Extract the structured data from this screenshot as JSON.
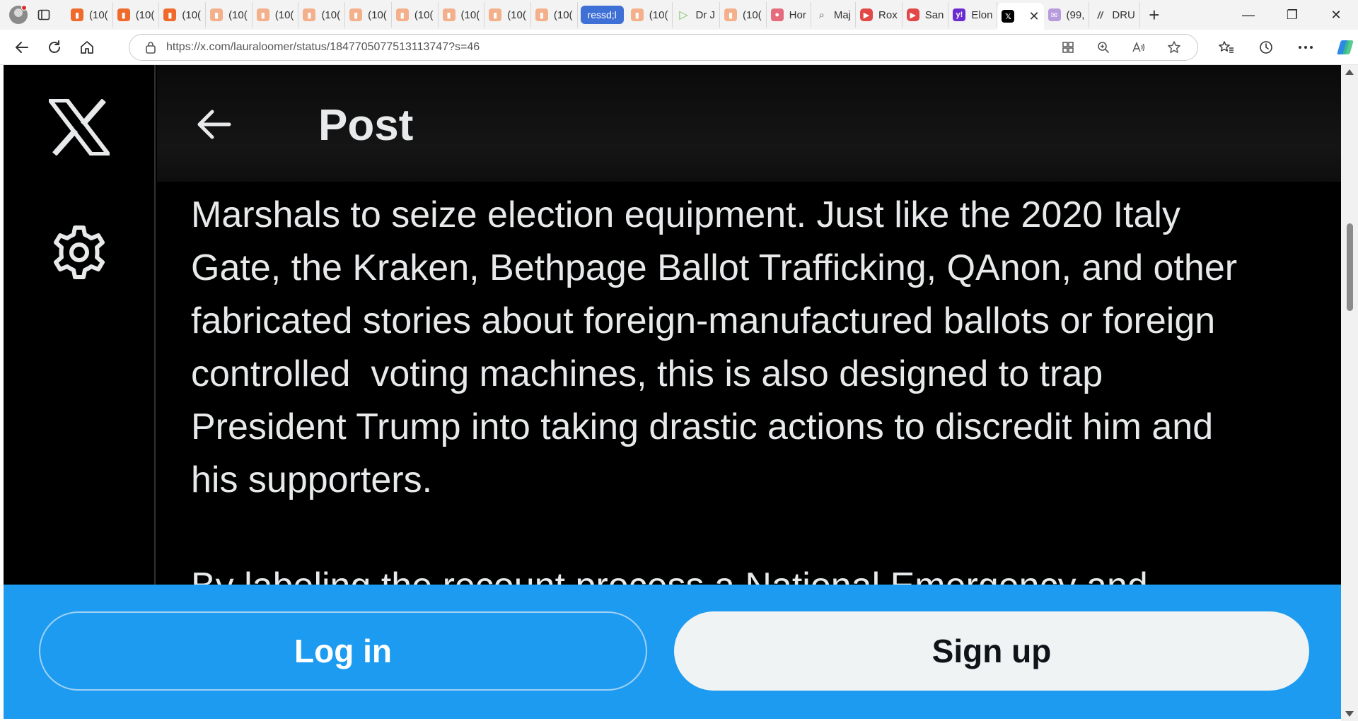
{
  "browser": {
    "tabs": [
      {
        "icon": "bookmark-icon",
        "color": "orange",
        "label": "(10(",
        "glyph": "▮"
      },
      {
        "icon": "bookmark-icon",
        "color": "orange",
        "label": "(10(",
        "glyph": "▮"
      },
      {
        "icon": "bookmark-icon",
        "color": "orange",
        "label": "(10(",
        "glyph": "▮"
      },
      {
        "icon": "bookmark-icon",
        "color": "peach",
        "label": "(10(",
        "glyph": "▮"
      },
      {
        "icon": "bookmark-icon",
        "color": "peach",
        "label": "(10(",
        "glyph": "▮"
      },
      {
        "icon": "bookmark-icon",
        "color": "peach",
        "label": "(10(",
        "glyph": "▮"
      },
      {
        "icon": "bookmark-icon",
        "color": "peach",
        "label": "(10(",
        "glyph": "▮"
      },
      {
        "icon": "bookmark-icon",
        "color": "peach",
        "label": "(10(",
        "glyph": "▮"
      },
      {
        "icon": "bookmark-icon",
        "color": "peach",
        "label": "(10(",
        "glyph": "▮"
      },
      {
        "icon": "bookmark-icon",
        "color": "peach",
        "label": "(10(",
        "glyph": "▮"
      },
      {
        "icon": "bookmark-icon",
        "color": "peach",
        "label": "(10(",
        "glyph": "▮"
      }
    ],
    "special_tab": "ressd;l",
    "tabs_after": [
      {
        "icon": "bookmark-icon",
        "color": "peach",
        "label": "(10(",
        "glyph": "▮"
      },
      {
        "icon": "play-icon",
        "color": "green",
        "label": "Dr J",
        "glyph": "▷"
      },
      {
        "icon": "bookmark-icon",
        "color": "peach",
        "label": "(10(",
        "glyph": "▮"
      },
      {
        "icon": "person-icon",
        "color": "pink",
        "label": "Hor",
        "glyph": "●"
      },
      {
        "icon": "search-icon",
        "color": "gray",
        "label": "Maj",
        "glyph": "⌕"
      },
      {
        "icon": "youtube-icon",
        "color": "red",
        "label": "Rox",
        "glyph": "▶"
      },
      {
        "icon": "youtube-icon",
        "color": "red",
        "label": "San",
        "glyph": "▶"
      },
      {
        "icon": "yahoo-icon",
        "color": "purple",
        "label": "Elon",
        "glyph": "y!"
      }
    ],
    "active_tab": {
      "icon": "x-logo-icon",
      "glyph": "𝕏",
      "close": "✕"
    },
    "tabs_end": [
      {
        "icon": "mail-icon",
        "color": "lilac",
        "label": "(99,",
        "glyph": "✉"
      },
      {
        "icon": "dr-icon",
        "color": "gray2",
        "label": "DRU",
        "glyph": "//"
      }
    ],
    "new_tab": "+",
    "window": {
      "minimize": "—",
      "restore": "❐",
      "close": "✕"
    },
    "url": "https://x.com/lauraloomer/status/1847705077513113747?s=46"
  },
  "post": {
    "header_title": "Post",
    "text_lines": [
      "Marshals to seize election equipment. Just like the 2020 Italy",
      "Gate, the Kraken, Bethpage Ballot Trafficking, QAnon, and other",
      "fabricated stories about foreign-manufactured ballots or foreign",
      "controlled  voting machines, this is also designed to trap",
      "President Trump into taking drastic actions to discredit him and",
      "his supporters."
    ],
    "cutoff_line": "By labeling the recount process a National Emergency and"
  },
  "auth": {
    "login_label": "Log in",
    "signup_label": "Sign up"
  },
  "colors": {
    "accent": "#1d9bf0",
    "background": "#000000",
    "text": "#e7e9ea"
  }
}
